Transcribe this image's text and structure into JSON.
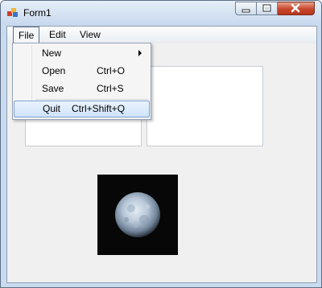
{
  "window": {
    "title": "Form1",
    "icon": "winforms-app-icon",
    "controls": [
      "minimize-icon",
      "maximize-icon",
      "close-icon"
    ]
  },
  "menubar": {
    "items": [
      {
        "label": "File"
      },
      {
        "label": "Edit"
      },
      {
        "label": "View"
      }
    ]
  },
  "file_menu": {
    "open": true,
    "items": [
      {
        "label": "New",
        "shortcut": "",
        "has_submenu": true
      },
      {
        "label": "Open",
        "shortcut": "Ctrl+O"
      },
      {
        "label": "Save",
        "shortcut": "Ctrl+S"
      },
      {
        "label": "Quit",
        "shortcut": "Ctrl+Shift+Q",
        "highlighted": true
      }
    ]
  },
  "picture": {
    "description_icon": "moon-image"
  },
  "colors": {
    "close_button": "#c7462c",
    "highlight_border": "#7da2ce",
    "client_background": "#f0f0f0"
  }
}
